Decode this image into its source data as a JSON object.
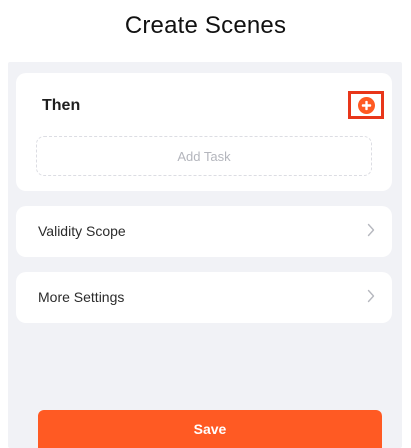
{
  "header": {
    "title": "Create Scenes"
  },
  "then_section": {
    "title": "Then",
    "add_icon": "plus-circle-icon",
    "highlight_color": "#e8361a",
    "add_task_placeholder": "Add Task"
  },
  "settings_rows": [
    {
      "label": "Validity Scope",
      "icon": "chevron-right-icon"
    },
    {
      "label": "More Settings",
      "icon": "chevron-right-icon"
    }
  ],
  "footer": {
    "save_label": "Save",
    "accent_color": "#ff5a23"
  }
}
